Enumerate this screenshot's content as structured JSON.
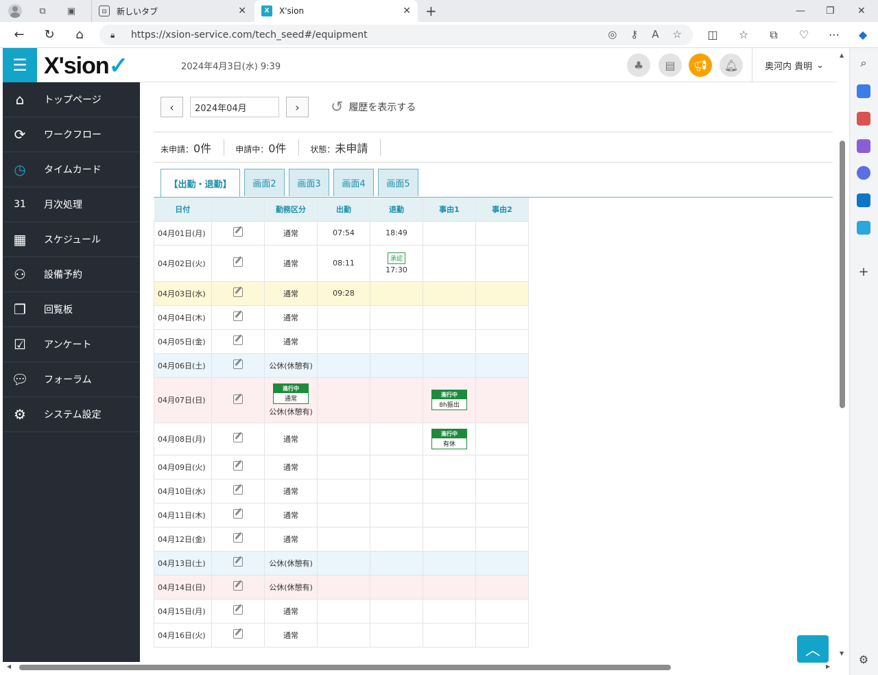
{
  "browser": {
    "tabs": [
      {
        "label": "新しいタブ",
        "fav": "⊡"
      },
      {
        "label": "X'sion",
        "fav": "X"
      }
    ],
    "url": "https://xsion-service.com/tech_seed#/equipment"
  },
  "header": {
    "logo": "X'sion",
    "datetime": "2024年4月3日(水) 9:39",
    "user": "奥河内 貴明"
  },
  "sidebar": {
    "items": [
      {
        "label": "トップページ",
        "icon": "home-icon"
      },
      {
        "label": "ワークフロー",
        "icon": "workflow-icon"
      },
      {
        "label": "タイムカード",
        "icon": "timecard-icon"
      },
      {
        "label": "月次処理",
        "icon": "calendar-31-icon"
      },
      {
        "label": "スケジュール",
        "icon": "schedule-icon"
      },
      {
        "label": "設備予約",
        "icon": "people-icon"
      },
      {
        "label": "回覧板",
        "icon": "clipboard-icon"
      },
      {
        "label": "アンケート",
        "icon": "survey-icon"
      },
      {
        "label": "フォーラム",
        "icon": "chat-icon"
      },
      {
        "label": "システム設定",
        "icon": "gear-icon"
      }
    ]
  },
  "main": {
    "month": "2024年04月",
    "history_label": "履歴を表示する",
    "status": {
      "unapplied_label": "未申請：",
      "unapplied_count": "0件",
      "applying_label": "申請中：",
      "applying_count": "0件",
      "state_label": "状態：",
      "state_value": "未申請"
    },
    "tabs": [
      "【出勤・退勤】",
      "画面2",
      "画面3",
      "画面4",
      "画面5"
    ],
    "columns": [
      "日付",
      "",
      "勤務区分",
      "出勤",
      "退勤",
      "事由1",
      "事由2"
    ],
    "rows": [
      {
        "date": "04月01日(月)",
        "kubun": "通常",
        "in": "07:54",
        "out": "18:49",
        "r1": "",
        "r2": "",
        "type": ""
      },
      {
        "date": "04月02日(火)",
        "kubun": "通常",
        "in": "08:11",
        "out": "17:30",
        "out_badge": "承認",
        "r1": "",
        "r2": "",
        "type": ""
      },
      {
        "date": "04月03日(水)",
        "kubun": "通常",
        "in": "09:28",
        "out": "",
        "r1": "",
        "r2": "",
        "type": "today"
      },
      {
        "date": "04月04日(木)",
        "kubun": "通常",
        "in": "",
        "out": "",
        "r1": "",
        "r2": "",
        "type": ""
      },
      {
        "date": "04月05日(金)",
        "kubun": "通常",
        "in": "",
        "out": "",
        "r1": "",
        "r2": "",
        "type": ""
      },
      {
        "date": "04月06日(土)",
        "kubun": "公休(休憩有)",
        "in": "",
        "out": "",
        "r1": "",
        "r2": "",
        "type": "sat"
      },
      {
        "date": "04月07日(日)",
        "kubun": "公休(休憩有)",
        "kubun_badge_top": "進行中",
        "kubun_badge_bottom": "通常",
        "in": "",
        "out": "",
        "r1_badge_top": "進行中",
        "r1_badge_bottom": "8h振出",
        "r2": "",
        "type": "sun"
      },
      {
        "date": "04月08日(月)",
        "kubun": "通常",
        "in": "",
        "out": "",
        "r1_badge_top": "進行中",
        "r1_badge_bottom": "有休",
        "r2": "",
        "type": ""
      },
      {
        "date": "04月09日(火)",
        "kubun": "通常",
        "in": "",
        "out": "",
        "r1": "",
        "r2": "",
        "type": ""
      },
      {
        "date": "04月10日(水)",
        "kubun": "通常",
        "in": "",
        "out": "",
        "r1": "",
        "r2": "",
        "type": ""
      },
      {
        "date": "04月11日(木)",
        "kubun": "通常",
        "in": "",
        "out": "",
        "r1": "",
        "r2": "",
        "type": ""
      },
      {
        "date": "04月12日(金)",
        "kubun": "通常",
        "in": "",
        "out": "",
        "r1": "",
        "r2": "",
        "type": ""
      },
      {
        "date": "04月13日(土)",
        "kubun": "公休(休憩有)",
        "in": "",
        "out": "",
        "r1": "",
        "r2": "",
        "type": "sat"
      },
      {
        "date": "04月14日(日)",
        "kubun": "公休(休憩有)",
        "in": "",
        "out": "",
        "r1": "",
        "r2": "",
        "type": "sun"
      },
      {
        "date": "04月15日(月)",
        "kubun": "通常",
        "in": "",
        "out": "",
        "r1": "",
        "r2": "",
        "type": ""
      },
      {
        "date": "04月16日(火)",
        "kubun": "通常",
        "in": "",
        "out": "",
        "r1": "",
        "r2": "",
        "type": ""
      }
    ]
  },
  "colors": {
    "accent": "#13a4c9",
    "sidebar_bg": "#272c34",
    "today_bg": "#fdf8d6",
    "sat_bg": "#eaf5fc",
    "sun_bg": "#fdeef0",
    "badge_green": "#1e8a3c"
  }
}
